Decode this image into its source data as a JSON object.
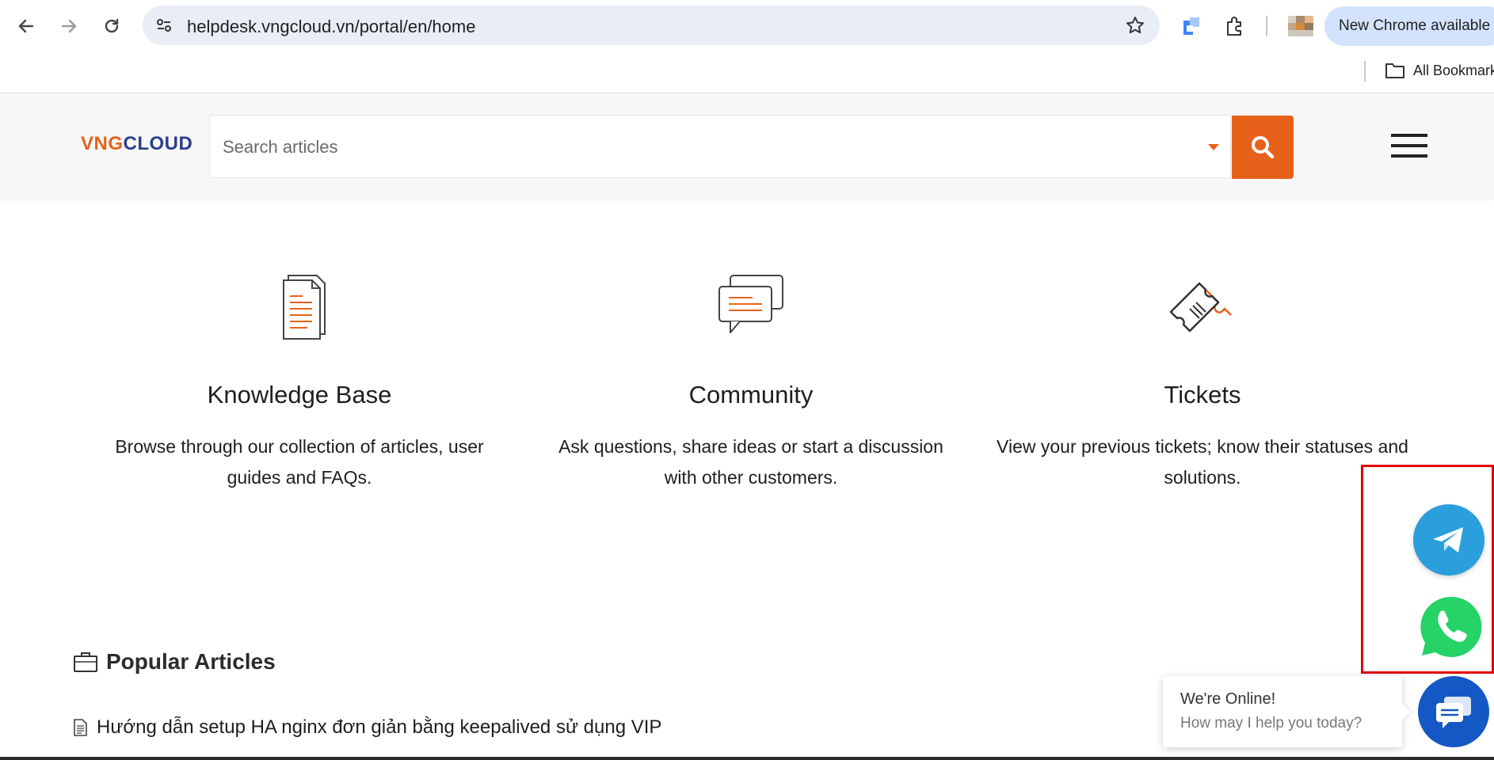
{
  "browser": {
    "url": "helpdesk.vngcloud.vn/portal/en/home",
    "update_label": "New Chrome available",
    "bookmarks_label": "All Bookmarks"
  },
  "header": {
    "logo_part1": "VNG",
    "logo_part2": "CLOUD",
    "search_placeholder": "Search articles"
  },
  "features": [
    {
      "title": "Knowledge Base",
      "description": "Browse through our collection of articles, user guides and FAQs.",
      "icon": "documents-icon"
    },
    {
      "title": "Community",
      "description": "Ask questions, share ideas or start a discussion with other customers.",
      "icon": "chat-bubbles-icon"
    },
    {
      "title": "Tickets",
      "description": "View your previous tickets; know their statuses and solutions.",
      "icon": "ticket-icon"
    }
  ],
  "popular": {
    "title": "Popular Articles",
    "articles": [
      {
        "title": "Hướng dẫn setup HA nginx đơn giản bằng keepalived sử dụng VIP"
      }
    ]
  },
  "chat": {
    "online": "We're Online!",
    "prompt": "How may I help you today?"
  },
  "colors": {
    "brand_orange": "#e8611a",
    "brand_navy": "#2c3e8f",
    "telegram": "#2a9fdb",
    "whatsapp": "#25d366",
    "chat": "#1458c6",
    "highlight": "#e00000"
  }
}
